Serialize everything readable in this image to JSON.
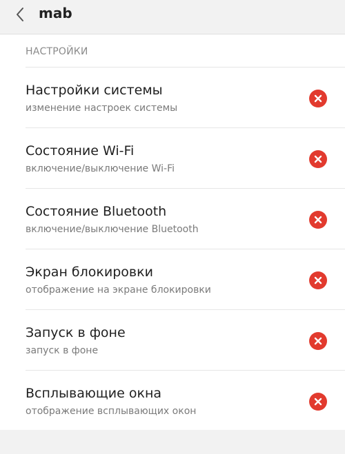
{
  "header": {
    "title": "mab",
    "back_icon": "chevron-left-icon"
  },
  "section": {
    "label": "НАСТРОЙКИ"
  },
  "permissions": [
    {
      "title": "Настройки системы",
      "subtitle": "изменение настроек системы",
      "status_icon": "deny-x-icon"
    },
    {
      "title": "Состояние Wi-Fi",
      "subtitle": "включение/выключение Wi-Fi",
      "status_icon": "deny-x-icon"
    },
    {
      "title": "Состояние Bluetooth",
      "subtitle": "включение/выключение Bluetooth",
      "status_icon": "deny-x-icon"
    },
    {
      "title": "Экран блокировки",
      "subtitle": "отображение на экране блокировки",
      "status_icon": "deny-x-icon"
    },
    {
      "title": "Запуск в фоне",
      "subtitle": "запуск в фоне",
      "status_icon": "deny-x-icon"
    },
    {
      "title": "Всплывающие окна",
      "subtitle": "отображение всплывающих окон",
      "status_icon": "deny-x-icon"
    }
  ],
  "colors": {
    "background": "#f2f2f2",
    "surface": "#ffffff",
    "deny_red": "#e23a2e",
    "divider": "#e6e6e6"
  }
}
